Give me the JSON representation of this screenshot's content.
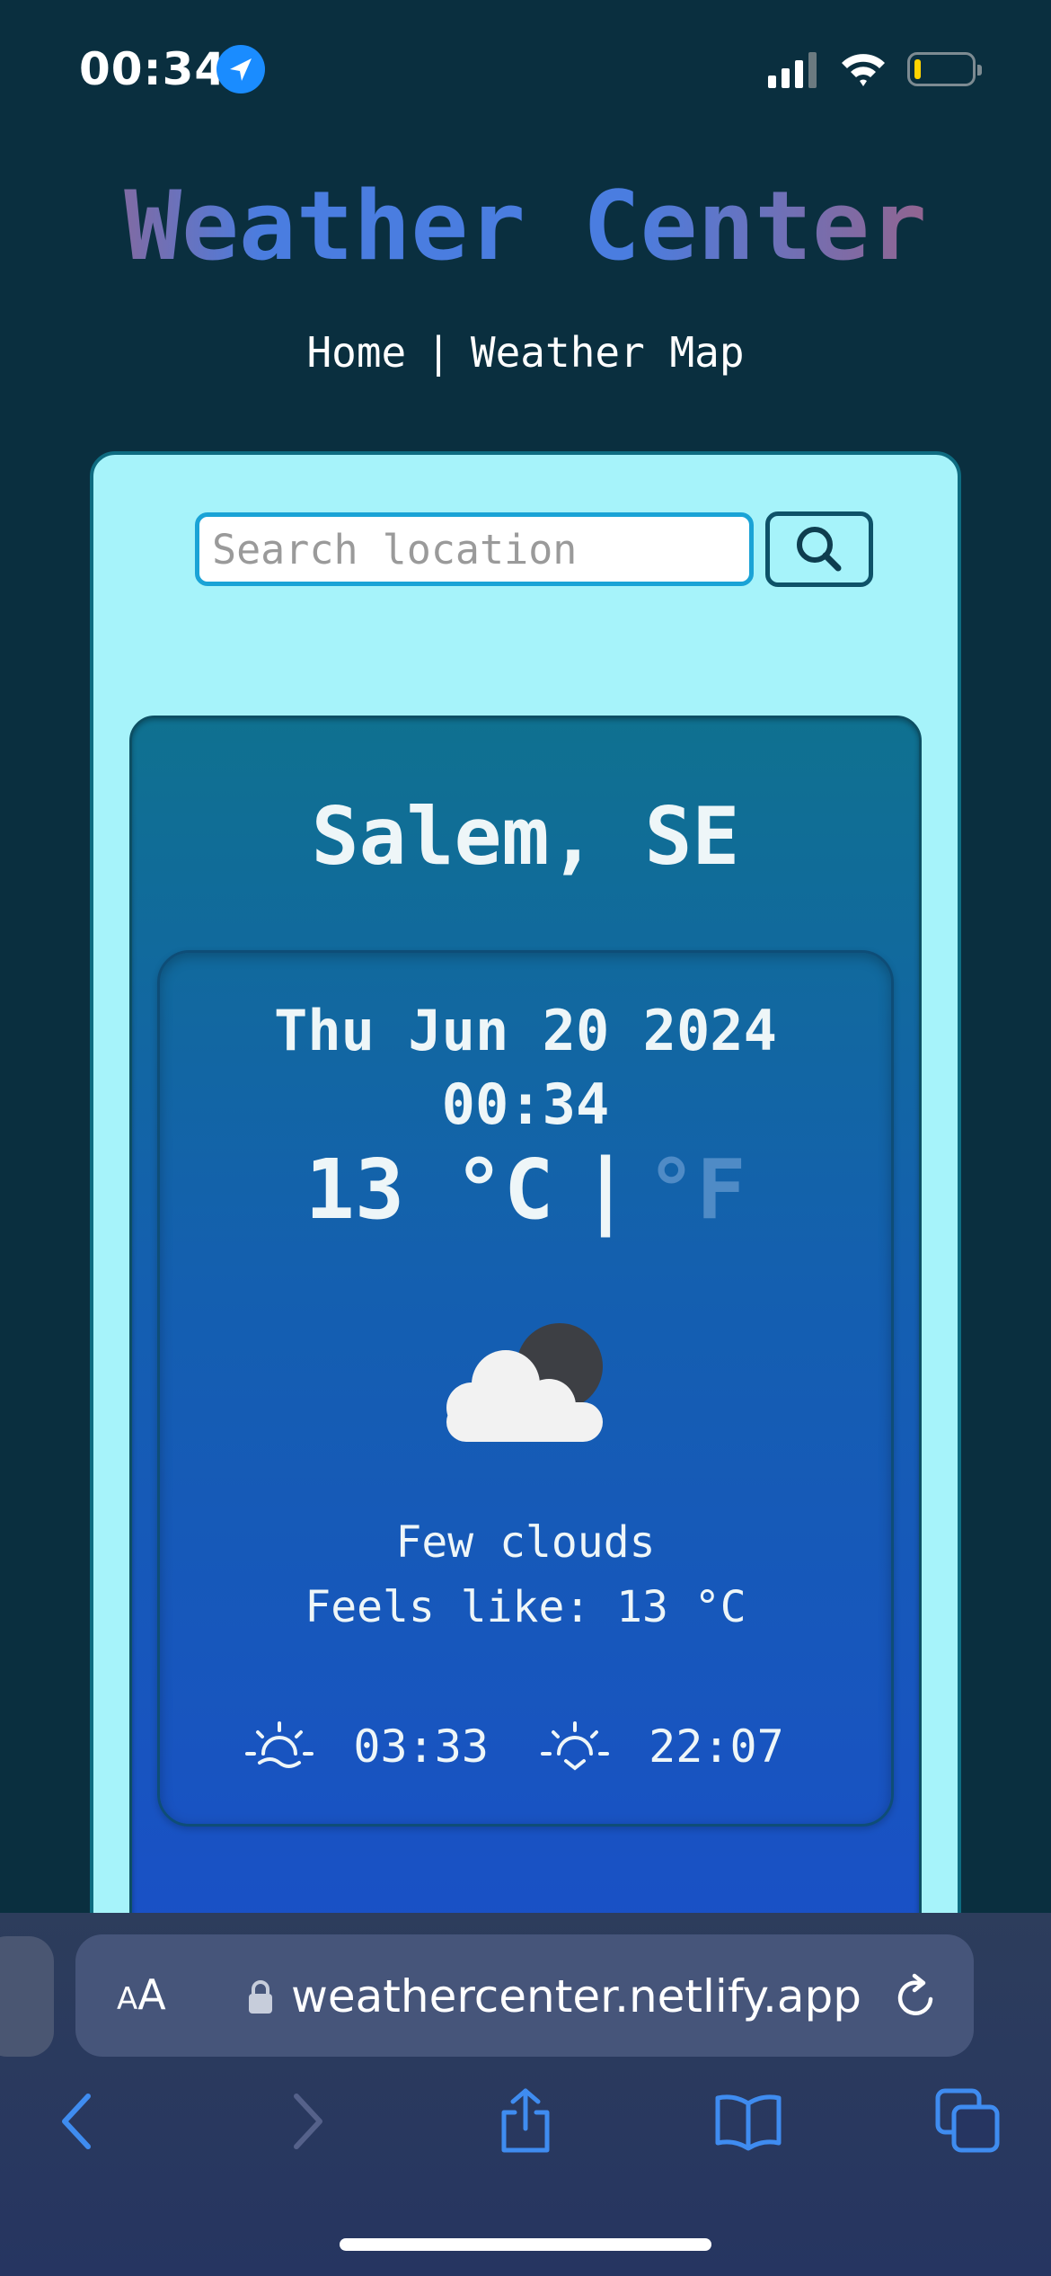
{
  "status_bar": {
    "time": "00:34"
  },
  "header": {
    "title": "Weather Center",
    "nav": {
      "home": "Home",
      "separator": "|",
      "map": "Weather Map"
    }
  },
  "search": {
    "placeholder": "Search location",
    "value": ""
  },
  "weather": {
    "city": "Salem, SE",
    "date": "Thu Jun 20 2024",
    "time": "00:34",
    "temperature": "13",
    "unit_c": "°C",
    "unit_divider": "|",
    "unit_f": "°F",
    "condition_icon": "few-clouds-night-icon",
    "description": "Few clouds",
    "feels_like": "Feels like: 13 °C",
    "sunrise": "03:33",
    "sunset": "22:07"
  },
  "browser": {
    "aa_large": "A",
    "aa_small": "A",
    "url": "weathercenter.netlify.app"
  },
  "colors": {
    "page_bg": "#0a2f3f",
    "panel_bg": "#a6f3fa",
    "card_top": "#0f7190",
    "card_bottom": "#1a4fc8",
    "accent": "#1a8cff"
  }
}
